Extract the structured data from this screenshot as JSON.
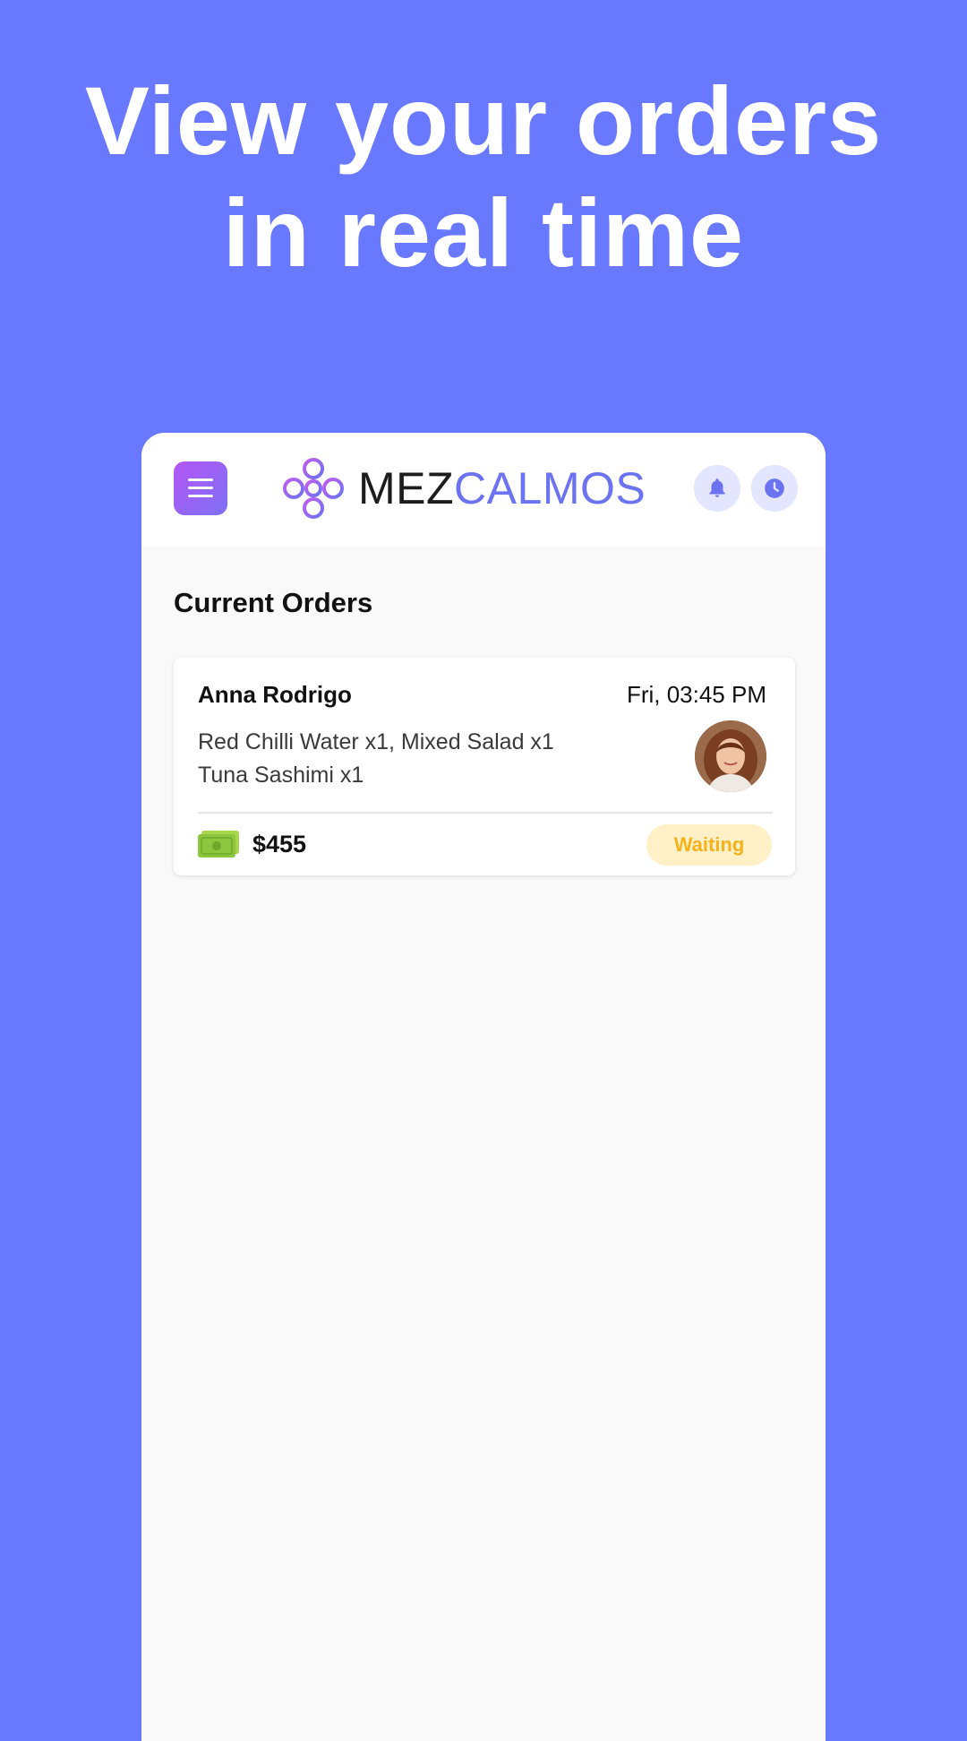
{
  "headline": {
    "line1": "View your orders",
    "line2": "in real time"
  },
  "appbar": {
    "logo_part1": "MEZ",
    "logo_part2": "CALMOS",
    "icons": [
      "menu-icon",
      "bell-icon",
      "clock-icon"
    ]
  },
  "orders": {
    "section_title": "Current Orders",
    "items": [
      {
        "customer": "Anna Rodrigo",
        "time": "Fri, 03:45 PM",
        "items_line1": "Red Chilli Water x1, Mixed Salad x1",
        "items_line2": "Tuna Sashimi x1",
        "price": "$455",
        "status": "Waiting",
        "payment_icon": "cash-icon"
      }
    ]
  },
  "colors": {
    "background": "#6979FF",
    "accent": "#6B73F1",
    "status_waiting_text": "#F6B21A",
    "status_waiting_bg": "#FFF0C7"
  }
}
